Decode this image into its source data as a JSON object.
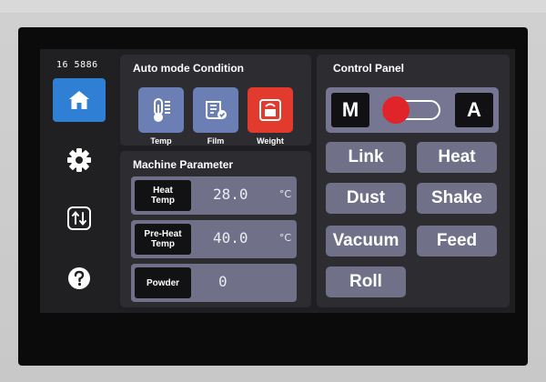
{
  "status": {
    "station_id": "16 5886"
  },
  "sidebar": {
    "items": [
      {
        "name": "home",
        "icon": "home-icon"
      },
      {
        "name": "settings",
        "icon": "gear-icon"
      },
      {
        "name": "transfer",
        "icon": "sort-arrows-icon"
      },
      {
        "name": "help",
        "icon": "help-icon"
      }
    ],
    "active": "home"
  },
  "auto_mode": {
    "title": "Auto mode Condition",
    "items": [
      {
        "label": "Temp",
        "icon": "thermometer-icon"
      },
      {
        "label": "Film",
        "icon": "film-roll-icon"
      },
      {
        "label": "Weight",
        "icon": "weight-icon"
      }
    ],
    "selected": "Weight"
  },
  "machine_parameter": {
    "title": "Machine Parameter",
    "rows": [
      {
        "label_line1": "Heat",
        "label_line2": "Temp",
        "value": "28.0",
        "unit": "°C"
      },
      {
        "label_line1": "Pre-Heat",
        "label_line2": "Temp",
        "value": "40.0",
        "unit": "°C"
      },
      {
        "label_line1": "Powder",
        "label_line2": "",
        "value": "0",
        "unit": ""
      }
    ]
  },
  "control_panel": {
    "title": "Control Panel",
    "manual_label": "M",
    "auto_label": "A",
    "mode": "manual",
    "buttons": [
      "Link",
      "Heat",
      "Dust",
      "Shake",
      "Vacuum",
      "Feed",
      "Roll"
    ]
  },
  "colors": {
    "accent_blue": "#2f7fd4",
    "tile_blue": "#6b7fb5",
    "active_red": "#e23b2e",
    "button_grey": "#707089",
    "panel_bg": "#2d2d31",
    "toggle_knob": "#e0242a"
  }
}
